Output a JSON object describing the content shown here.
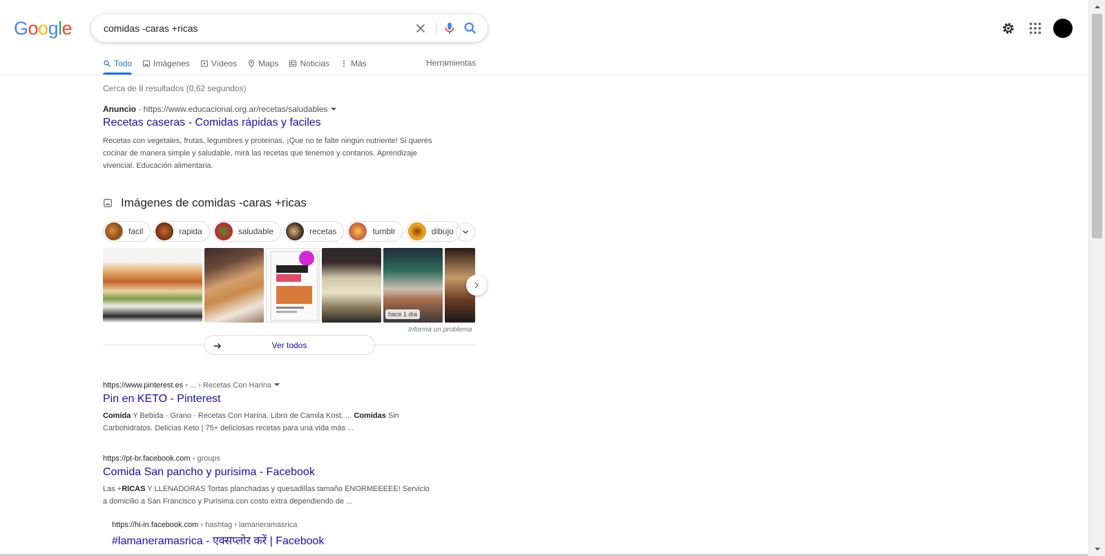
{
  "logo": {
    "letters": [
      "G",
      "o",
      "o",
      "g",
      "l",
      "e"
    ],
    "colors": [
      "#4285F4",
      "#EA4335",
      "#FBBC05",
      "#4285F4",
      "#34A853",
      "#EA4335"
    ]
  },
  "search": {
    "query": "comidas -caras +ricas"
  },
  "tabs": [
    {
      "label": "Todo",
      "icon": "search-icon",
      "active": true
    },
    {
      "label": "Imágenes",
      "icon": "image-icon"
    },
    {
      "label": "Vídeos",
      "icon": "play-icon"
    },
    {
      "label": "Maps",
      "icon": "map-pin-icon"
    },
    {
      "label": "Noticias",
      "icon": "news-icon"
    },
    {
      "label": "Más",
      "icon": "more-vert-icon"
    }
  ],
  "tools_label": "Herramientas",
  "results_count": "Cerca de 8 resultados (0,62 segundos)",
  "ad": {
    "badge": "Anuncio",
    "url": "https://www.educacional.org.ar/recetas/saludables",
    "title": "Recetas caseras - Comidas rápidas y faciles",
    "desc": "Recetas con vegetales, frutas, legumbres y proteínas. ¡Que no te falte ningún nutriente! Si querés cocinar de manera simple y saludable, mirá las recetas que tenemos y contanos. Aprendizaje vivencial. Educación alimentaria."
  },
  "images": {
    "heading": "Imágenes de comidas -caras +ricas",
    "chips": [
      "facil",
      "rapida",
      "saludable",
      "recetas",
      "tumblr",
      "dibujo"
    ],
    "recent_badge": "hace 1 día",
    "report": "Informa un problema",
    "see_all": "Ver todos"
  },
  "results": [
    {
      "site": "https://www.pinterest.es",
      "path": " › ... › Recetas Con Harina",
      "title": "Pin en KETO - Pinterest",
      "desc_html": "<b>Comida</b> Y Bebida · Grano · Recetas Con Harina. Libro de Camila Kost, ... <b>Comidas</b> Sin Carbohidratos. Delicias Keto | 75+ deliciosas recetas para una vida más ..."
    },
    {
      "site": "https://pt-br.facebook.com",
      "path": " › groups",
      "title": "Comida San pancho y purisima - Facebook",
      "desc_html": "Las +<b>RICAS</b> Y LLENADORAS Tortas planchadas y quesadillas tamaño ENORMEEEEE! Servicio a domicilio a San Francisco y Purísima con costo extra dependiendo de ..."
    },
    {
      "site": "https://hi-in.facebook.com",
      "path": " › hashtag › lamaneramasrica",
      "title": "#lamaneramasrica - एक्सप्लोर करें | Facebook",
      "desc_html": ""
    }
  ]
}
